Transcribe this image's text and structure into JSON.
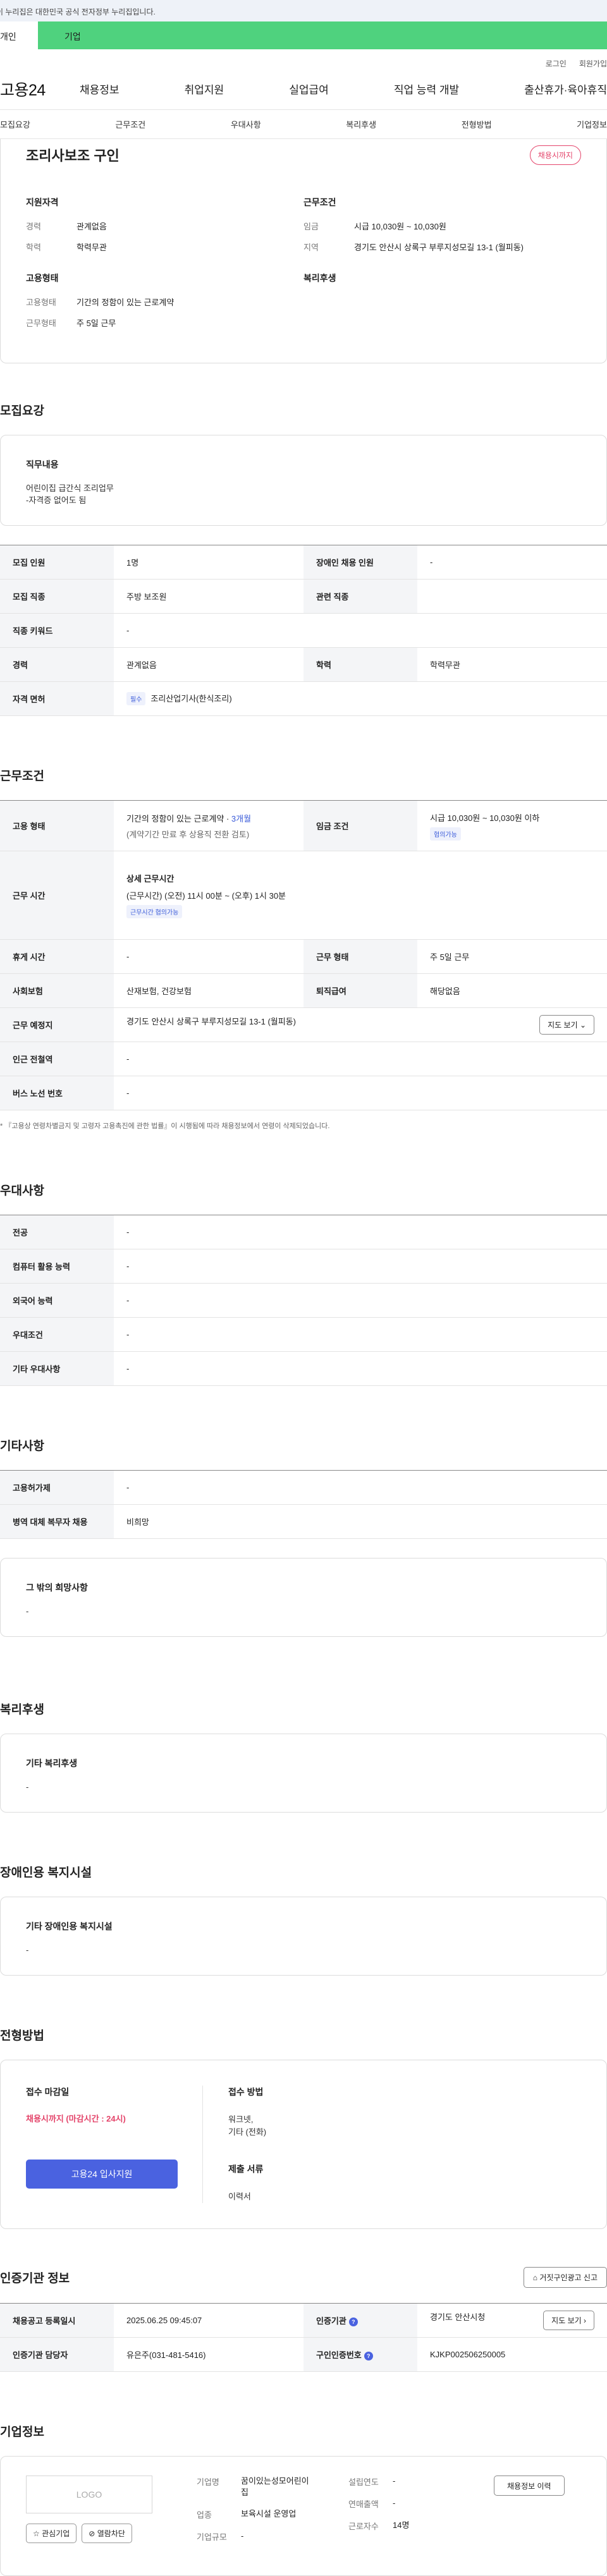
{
  "gov_banner": "이 누리집은 대한민국 공식 전자정부 누리집입니다.",
  "top_tabs": [
    "개인",
    "기업"
  ],
  "util": {
    "login": "로그인",
    "join": "회원가입"
  },
  "logo": "고용24",
  "gnb": [
    "채용정보",
    "취업지원",
    "실업급여",
    "직업 능력 개발",
    "출산휴가·육아휴직"
  ],
  "anchor_nav": [
    "모집요강",
    "근무조건",
    "우대사항",
    "복리후생",
    "전형방법",
    "기업정보"
  ],
  "header": {
    "title": "조리사보조 구인",
    "status_badge": "채용시까지",
    "qualifications": {
      "heading": "지원자격",
      "rows": [
        {
          "k": "경력",
          "v": "관계없음"
        },
        {
          "k": "학력",
          "v": "학력무관"
        }
      ]
    },
    "employment": {
      "heading": "고용형태",
      "rows": [
        {
          "k": "고용형태",
          "v": "기간의 정함이 있는 근로계약"
        },
        {
          "k": "근무형태",
          "v": "주 5일 근무"
        }
      ]
    },
    "conditions": {
      "heading": "근무조건",
      "rows": [
        {
          "k": "임금",
          "v": "시급 10,030원 ~ 10,030원"
        },
        {
          "k": "지역",
          "v": "경기도 안산시 상록구 부루지성모길 13-1 (월피동)"
        }
      ]
    },
    "welfare_heading": "복리후생"
  },
  "recruit": {
    "heading": "모집요강",
    "duty_title": "직무내용",
    "duty_text": "어린이집 급간식 조리업무\n-자격증 없어도 됨",
    "table": {
      "r1": {
        "k1": "모집 인원",
        "v1": "1명",
        "k2": "장애인 채용 인원",
        "v2": "-"
      },
      "r2": {
        "k1": "모집 직종",
        "v1": "주방 보조원",
        "k2": "관련 직종",
        "v2": ""
      },
      "r3": {
        "k1": "직종 키워드",
        "v1": "-"
      },
      "r4": {
        "k1": "경력",
        "v1": "관계없음",
        "k2": "학력",
        "v2": "학력무관"
      },
      "r5": {
        "k1": "자격 면허",
        "tag": "필수",
        "v1": "조리산업기사(한식조리)"
      }
    }
  },
  "work": {
    "heading": "근무조건",
    "type_k": "고용 형태",
    "type_v": "기간의 정함이 있는 근로계약 · ",
    "type_period": "3개월",
    "type_note": "(계약기간 만료 후 상용직 전환 검토)",
    "wage_k": "임금 조건",
    "wage_v": "시급 10,030원 ~ 10,030원 이하",
    "wage_tag": "협의가능",
    "hours_k": "근무 시간",
    "hours_title": "상세 근무시간",
    "hours_v": "(근무시간) (오전) 11시 00분 ~ (오후) 1시 30분",
    "hours_tag": "근무시간 협의가능",
    "break_k": "휴게 시간",
    "break_v": "-",
    "shift_k": "근무 형태",
    "shift_v": "주 5일 근무",
    "ins_k": "사회보험",
    "ins_v": "산재보험, 건강보험",
    "ret_k": "퇴직급여",
    "ret_v": "해당없음",
    "loc_k": "근무 예정지",
    "loc_v": "경기도 안산시 상록구 부루지성모길 13-1 (월피동)",
    "map_btn": "지도 보기",
    "station_k": "인근 전철역",
    "station_v": "-",
    "bus_k": "버스 노선 번호",
    "bus_v": "-",
    "note": "* 『고용상 연령차별금지 및 고령자 고용촉진에 관한 법률』이 시행됨에 따라 채용정보에서 연령이 삭제되었습니다."
  },
  "prefer": {
    "heading": "우대사항",
    "rows": [
      {
        "k": "전공",
        "v": "-"
      },
      {
        "k": "컴퓨터 활용 능력",
        "v": "-"
      },
      {
        "k": "외국어 능력",
        "v": "-"
      },
      {
        "k": "우대조건",
        "v": "-"
      },
      {
        "k": "기타 우대사항",
        "v": "-"
      }
    ]
  },
  "etc": {
    "heading": "기타사항",
    "rows": [
      {
        "k": "고용허가제",
        "v": "-"
      },
      {
        "k": "병역 대체 복무자 채용",
        "v": "비희망"
      }
    ],
    "box_title": "그 밖의 희망사항",
    "box_text": "-"
  },
  "welfare": {
    "heading": "복리후생",
    "box_title": "기타 복리후생",
    "box_text": "-"
  },
  "disabled": {
    "heading": "장애인용 복지시설",
    "box_title": "기타 장애인용 복지시설",
    "box_text": "-"
  },
  "apply": {
    "heading": "전형방법",
    "deadline_label": "접수 마감일",
    "deadline_value": "채용시까지 (마감시간 : 24시)",
    "apply_btn": "고용24 입사지원",
    "method_label": "접수 방법",
    "method_value": "워크넷,\n기타 (전화)",
    "docs_label": "제출 서류",
    "docs_value": "이력서"
  },
  "cert": {
    "heading": "인증기관 정보",
    "report_btn": "거짓구인광고 신고",
    "r1": {
      "k1": "채용공고 등록일시",
      "v1": "2025.06.25 09:45:07",
      "k2": "인증기관",
      "v2": "경기도 안산시청",
      "map": "지도 보기"
    },
    "r2": {
      "k1": "인증기관 담당자",
      "v1": "유은주(031-481-5416)",
      "k2": "구인인증번호",
      "v2": "KJKP002506250005"
    }
  },
  "company": {
    "heading": "기업정보",
    "logo": "LOGO",
    "fav_btn": "관심기업",
    "block_btn": "열람차단",
    "name_k": "기업명",
    "name_v": "꿈이있는성모어린이집",
    "industry_k": "업종",
    "industry_v": "보육시설 운영업",
    "scale_k": "기업규모",
    "scale_v": "-",
    "founded_k": "설립연도",
    "founded_v": "-",
    "sales_k": "연매출액",
    "sales_v": "-",
    "staff_k": "근로자수",
    "staff_v": "14명",
    "history_btn": "채용정보 이력"
  },
  "colors": {
    "accent": "#4a62e0",
    "green": "#4fd27e",
    "alert": "#e4456b"
  }
}
